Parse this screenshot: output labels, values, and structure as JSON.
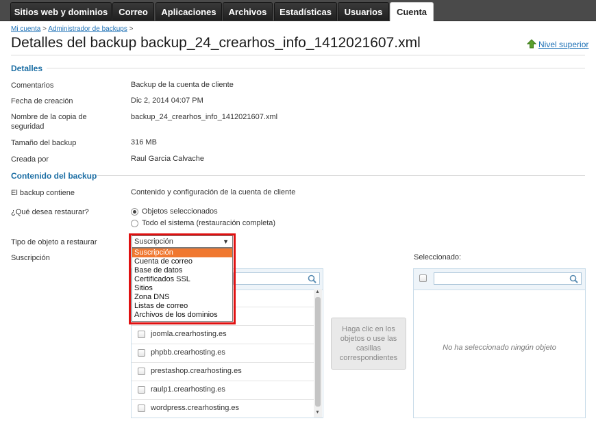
{
  "nav": {
    "tabs": [
      {
        "label": "Sitios web y dominios"
      },
      {
        "label": "Correo"
      },
      {
        "label": "Aplicaciones"
      },
      {
        "label": "Archivos"
      },
      {
        "label": "Estadísticas"
      },
      {
        "label": "Usuarios"
      },
      {
        "label": "Cuenta"
      }
    ]
  },
  "breadcrumb": {
    "home": "Mi cuenta",
    "sep": ">",
    "parent": "Administrador de backups",
    "sep2": ">"
  },
  "page": {
    "title": "Detalles del backup backup_24_crearhos_info_1412021607.xml",
    "up_link": "Nivel superior"
  },
  "details": {
    "heading": "Detalles",
    "rows": [
      {
        "label": "Comentarios",
        "value": "Backup de la cuenta de cliente"
      },
      {
        "label": "Fecha de creación",
        "value": "Dic 2, 2014 04:07 PM"
      },
      {
        "label": "Nombre de la copia de seguridad",
        "value": "backup_24_crearhos_info_1412021607.xml"
      },
      {
        "label": "Tamaño del backup",
        "value": "316 MB"
      },
      {
        "label": "Creada por",
        "value": "Raul Garcia Calvache"
      }
    ]
  },
  "content": {
    "heading": "Contenido del backup",
    "contains_label": "El backup contiene",
    "contains_value": "Contenido y configuración de la cuenta de cliente",
    "restore_label": "¿Qué desea restaurar?",
    "restore_options": [
      "Objetos seleccionados",
      "Todo el sistema (restauración completa)"
    ],
    "type_label": "Tipo de objeto a restaurar",
    "type_selected": "Suscripción",
    "type_options": [
      "Suscripción",
      "Cuenta de correo",
      "Base de datos",
      "Certificados SSL",
      "Sitios",
      "Zona DNS",
      "Listas de correo",
      "Archivos de los dominios"
    ],
    "subscription_label": "Suscripción"
  },
  "available": {
    "items": [
      "joomla.crearhosting.es",
      "phpbb.crearhosting.es",
      "prestashop.crearhosting.es",
      "raulp1.crearhosting.es",
      "wordpress.crearhosting.es"
    ]
  },
  "hint": "Haga clic en los objetos o use las casillas correspondientes",
  "selected": {
    "label": "Seleccionado:",
    "empty": "No ha seleccionado ningún objeto"
  }
}
